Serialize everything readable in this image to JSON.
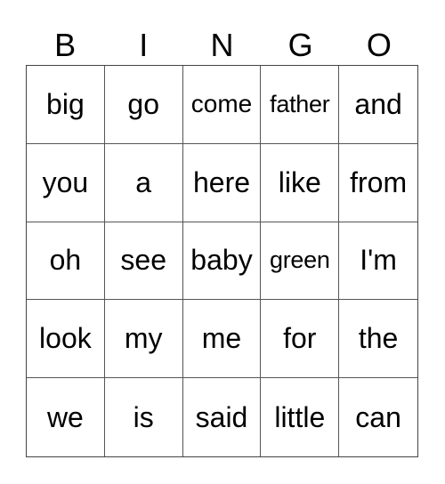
{
  "header": [
    "B",
    "I",
    "N",
    "G",
    "O"
  ],
  "rows": [
    [
      "big",
      "go",
      "come",
      "father",
      "and"
    ],
    [
      "you",
      "a",
      "here",
      "like",
      "from"
    ],
    [
      "oh",
      "see",
      "baby",
      "green",
      "I'm"
    ],
    [
      "look",
      "my",
      "me",
      "for",
      "the"
    ],
    [
      "we",
      "is",
      "said",
      "little",
      "can"
    ]
  ]
}
